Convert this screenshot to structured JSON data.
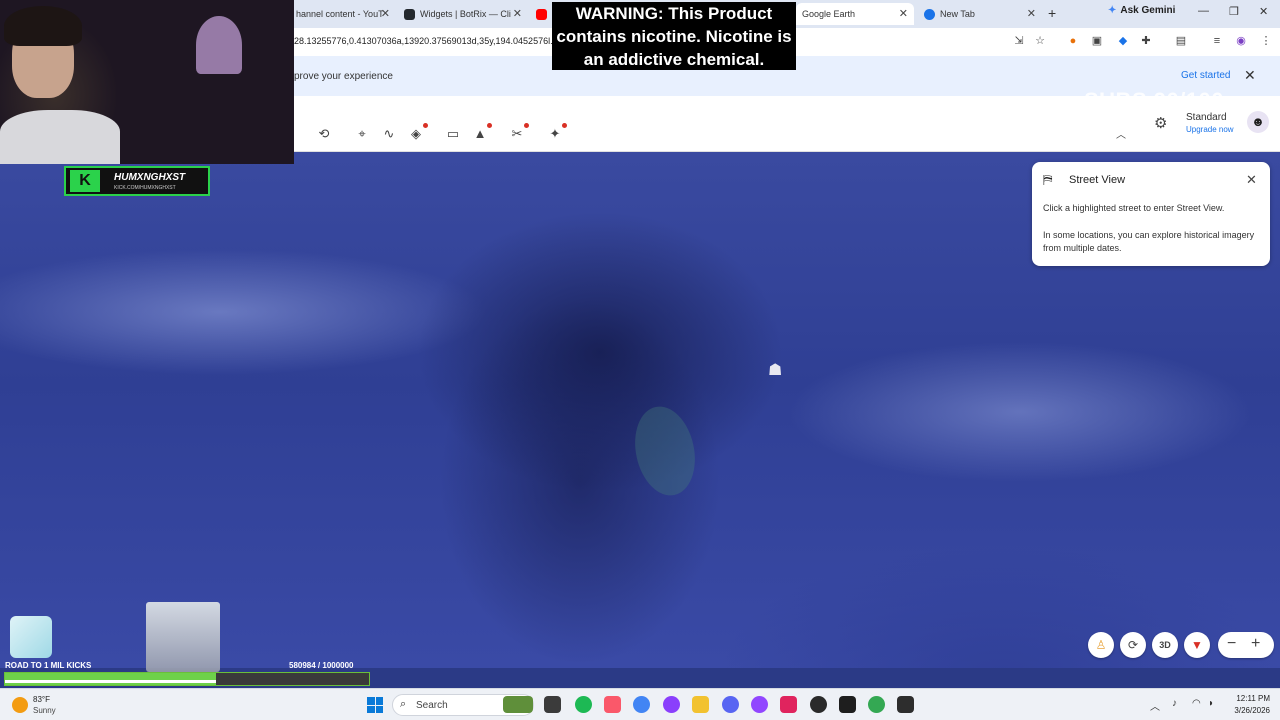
{
  "browser": {
    "tabs": [
      {
        "label": "hannel content - YouT",
        "favicon_color": "#ff0000"
      },
      {
        "label": "Widgets | BotRix — Cli",
        "favicon_color": "#24292e"
      },
      {
        "label": "Google Earth",
        "favicon_color": "#4285f4"
      },
      {
        "label": "New Tab",
        "favicon_color": "#1a73e8"
      }
    ],
    "ask_gemini": "Ask Gemini",
    "url": "28.13255776,0.41307036a,13920.37569013d,35y,194.0452576l...Hhk YzlwZGUzMzBmNThkOTBhKg1Nb3VudCBCZ..."
  },
  "banner": {
    "text": "prove your experience",
    "cta": "Get started"
  },
  "earth": {
    "plan": "Standard",
    "upgrade": "Upgrade now",
    "street_view": {
      "title": "Street View",
      "line1": "Click a highlighted street to enter Street View.",
      "line2": "In some locations, you can explore historical imagery from multiple dates."
    },
    "view_mode": "3D"
  },
  "stream": {
    "warning": "WARNING: This Product contains nicotine. Nicotine is an addictive chemical.",
    "subs": "SUBS 90/100",
    "logo_name": "HUMXNGHXST",
    "logo_url": "KICK.COM/HUMXNGHXST",
    "kicks_label": "ROAD TO 1 MIL KICKS",
    "kicks_count": "580984 / 1000000",
    "kicks_progress": 0.580984,
    "kicks_inner_progress": 0.58,
    "colors": {
      "accent_green": "#2bd24b",
      "bar_green": "#6ed14a"
    }
  },
  "taskbar": {
    "temp": "83°F",
    "condition": "Sunny",
    "search_label": "Search",
    "time": "12:11 PM",
    "date": "3/26/2026"
  }
}
